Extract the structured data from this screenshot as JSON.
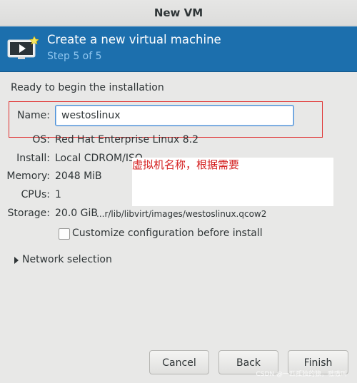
{
  "window": {
    "title": "New VM"
  },
  "banner": {
    "heading": "Create a new virtual machine",
    "step": "Step 5 of 5",
    "icon": "vm-monitor-icon"
  },
  "summary": {
    "ready_text": "Ready to begin the installation",
    "name_label": "Name:",
    "name_value": "westoslinux",
    "os_label": "OS:",
    "os_value": "Red Hat Enterprise Linux 8.2",
    "install_label": "Install:",
    "install_value": "Local CDROM/ISO",
    "memory_label": "Memory:",
    "memory_value": "2048 MiB",
    "cpus_label": "CPUs:",
    "cpus_value": "1",
    "storage_label": "Storage:",
    "storage_size": "20.0 GiB",
    "storage_path": "...r/lib/libvirt/images/westoslinux.qcow2"
  },
  "customize": {
    "label": "Customize configuration before install",
    "checked": false
  },
  "network": {
    "label": "Network selection",
    "expanded": false
  },
  "annotation": {
    "text": "虚拟机名称，根据需要",
    "color": "#d42020"
  },
  "buttons": {
    "cancel": "Cancel",
    "back": "Back",
    "finish": "Finish"
  },
  "watermark": "CSDN @一匹孤独的狼，嗷嗷叫",
  "colors": {
    "banner": "#1c6fad",
    "accent": "#4a90d9",
    "annotation_box": "#e03030"
  }
}
